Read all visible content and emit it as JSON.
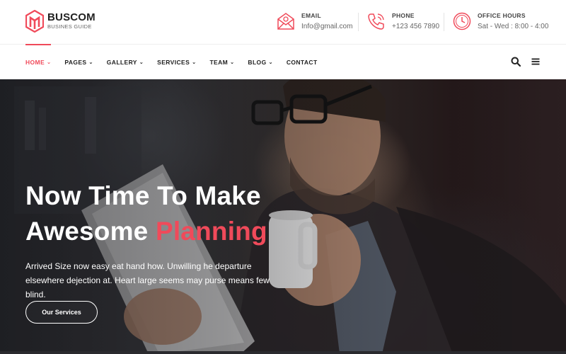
{
  "brand": {
    "name": "BUSCOM",
    "tagline": "BUSINES GUIDE",
    "accent_color": "#f04a5a"
  },
  "contacts": [
    {
      "icon": "email-icon",
      "label": "EMAIL",
      "value": "Info@gmail.com"
    },
    {
      "icon": "phone-icon",
      "label": "PHONE",
      "value": "+123 456 7890"
    },
    {
      "icon": "clock-icon",
      "label": "OFFICE HOURS",
      "value": "Sat - Wed : 8:00 - 4:00"
    }
  ],
  "nav": {
    "items": [
      {
        "label": "HOME",
        "dropdown": true,
        "active": true
      },
      {
        "label": "PAGES",
        "dropdown": true
      },
      {
        "label": "GALLERY",
        "dropdown": true
      },
      {
        "label": "SERVICES",
        "dropdown": true
      },
      {
        "label": "TEAM",
        "dropdown": true
      },
      {
        "label": "BLOG",
        "dropdown": true
      },
      {
        "label": "CONTACT",
        "dropdown": false
      }
    ],
    "tools": [
      "search-icon",
      "menu-icon"
    ]
  },
  "hero": {
    "title_line1": "Now Time To Make",
    "title_line2_plain": "Awesome",
    "title_line2_accent": "Planning",
    "description": "Arrived Size now easy eat hand how. Unwilling he departure elsewhere dejection at. Heart large seems may purse means few blind.",
    "button_label": "Our Services"
  }
}
